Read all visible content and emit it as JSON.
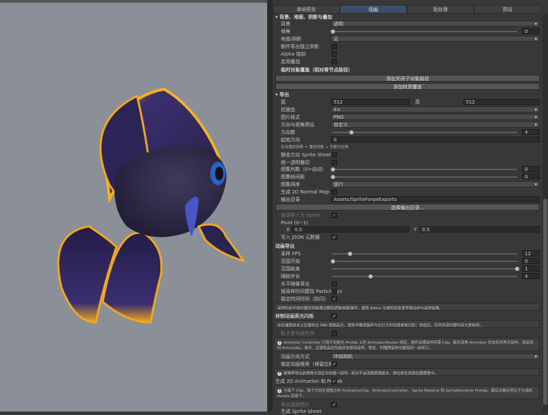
{
  "tabs": [
    "单帧预览",
    "动画",
    "批处理",
    "预设"
  ],
  "active_tab": 1,
  "bg_section": {
    "title": "▾ 背景、地面、阴影与叠加",
    "background_label": "背景",
    "background_value": "透明",
    "tilt_label": "倾角",
    "tilt_value": "0",
    "ground_shadow_label": "地面/阴影",
    "ground_shadow_value": "无",
    "export_shadow_label": "额外导出独立阴影",
    "alpha_label": "Alpha 蚀刻",
    "overlay_label": "启用叠加"
  },
  "attach_section": {
    "title": "临时对象覆盖（相对骨节点路径）",
    "add_path_btn": "添加关闭子对象路径",
    "add_material_btn": "添加材质覆盖"
  },
  "export_section": {
    "title": "▾ 导出",
    "width_label": "宽",
    "width_value": "512",
    "height_label": "高",
    "height_value": "512",
    "aa_label": "抗锯齿",
    "aa_value": "4×",
    "format_label": "图片格式",
    "format_value": "PNG",
    "dir_preset_label": "方向与视角预设",
    "dir_preset_value": "自定义",
    "dir_count_label": "方向数",
    "dir_count_value": "4",
    "start_dir_label": "起始方向",
    "start_dir_value": "0",
    "dir_hint": "有效播放频数 = 播放频数 + 总数方向角",
    "static_sheet_label": "静态方向 Sprite Sheet",
    "uniform_crop_label": "统一透明裁切",
    "atlas_cols_label": "图集列数（0=自动）",
    "atlas_cols_value": "0",
    "atlas_pad_label": "图集帧间距",
    "atlas_pad_value": "0",
    "atlas_order_label": "图集排序",
    "atlas_order_value": "逐行",
    "normal_map_label": "生成 2D Normal Map",
    "output_dir_label": "输出目录",
    "output_dir_value": "Assets/SpriteForgeExports",
    "choose_dir_btn": "选择输出目录..."
  },
  "import_section": {
    "auto_import_label": "自动导入为 Sprite",
    "pivot_label": "Pivot (0~1)",
    "pivot_x_label": "X",
    "pivot_x_value": "0.5",
    "pivot_y_label": "Y",
    "pivot_y_value": "0.5",
    "json_label": "写入 JSON 元数据"
  },
  "anim_section": {
    "title": "动画导出",
    "fps_label": "采样 FPS",
    "fps_value": "12",
    "start_label": "范围开始",
    "start_value": "0",
    "end_label": "范围结束",
    "end_value": "1",
    "step_label": "隔帧步长",
    "step_value": "4",
    "mirror_label": "水平镜像导出",
    "particle_label": "按采样时间模拟 ParticleSys",
    "stable_label": "稳定时间时间（防闪）",
    "stable_info": "采样时前半部内置的同帧通过模拟逻辑/刷新事件，避免 Editor 交换时间变更导致动作与采样结果。",
    "lock_light_label": "抑制动画高光闪烁",
    "lock_light_info": "在在捕获前未上压缩类且 PBR 镜面高光，避免华模类最终与光灯大时出现单帧闪烁；烘焙后，实时到采时跟时采光更新帧。",
    "particle_bind_label": "粒子参与帧检测",
    "controller_info": "Animator Controller 只用于初始化 Prefab 上的 Animator/Avatar 绑定，插件采播采样所需 Clip。能共享角 Animator 状态机并再次采样。请采用时 Entry/Idle、条件、过渡和高优先级状态修改采样。预览、列播预采样均使用同一采样口。",
    "dir_mode_label": "动画方向方式",
    "dir_mode_value": "环绕相机",
    "root_motion_label": "锁定动画根骨（保留位移）",
    "root_motion_info": "更推荐导出前根骨头锁定方向循一如所，绝对不会改根源源版本，根位修全改锁在跟跟里中。",
    "gen_anim_label": "生成 2D Animation 和 Prefab",
    "gen_anim_info": "为每个 Clip、每个方向生成独立的 AnimationClip、AnimatorController、Sprite Material 和 SpriteRenderer Prefab。最后合集必须位于生成的 Assets 目录下。",
    "export_anim_label": "导出逐帧图片",
    "gen_sheet_label": "生成 Sprite Sheet"
  },
  "colors": {
    "accent": "#3b5068",
    "fish_body": "#2f2a4a",
    "fish_fin_edge": "#f2a81c",
    "eye": "#2b62c8"
  }
}
